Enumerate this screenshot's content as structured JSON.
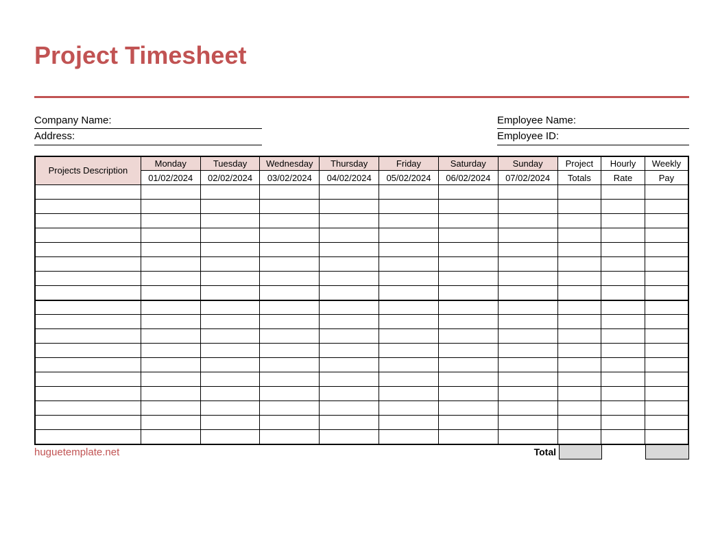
{
  "title": "Project Timesheet",
  "info": {
    "company_name_label": "Company Name:",
    "address_label": "Address:",
    "employee_name_label": "Employee Name:",
    "employee_id_label": "Employee ID:"
  },
  "headers": {
    "projects_description": "Projects Description",
    "days": [
      {
        "name": "Monday",
        "date": "01/02/2024"
      },
      {
        "name": "Tuesday",
        "date": "02/02/2024"
      },
      {
        "name": "Wednesday",
        "date": "03/02/2024"
      },
      {
        "name": "Thursday",
        "date": "04/02/2024"
      },
      {
        "name": "Friday",
        "date": "05/02/2024"
      },
      {
        "name": "Saturday",
        "date": "06/02/2024"
      },
      {
        "name": "Sunday",
        "date": "07/02/2024"
      }
    ],
    "project_totals_l1": "Project",
    "project_totals_l2": "Totals",
    "hourly_rate_l1": "Hourly",
    "hourly_rate_l2": "Rate",
    "weekly_pay_l1": "Weekly",
    "weekly_pay_l2": "Pay"
  },
  "rows_count": 18,
  "footer": {
    "site": "huguetemplate.net",
    "total_label": "Total"
  }
}
